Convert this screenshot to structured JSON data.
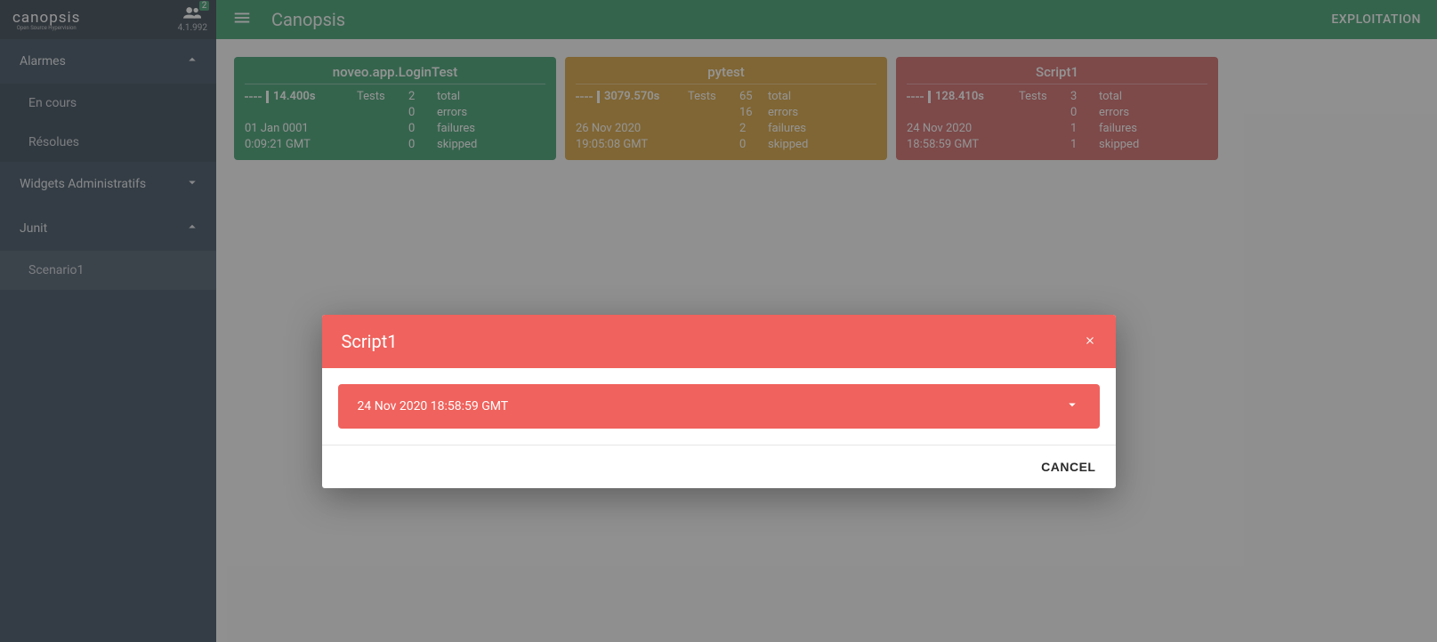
{
  "brand": {
    "name": "canopsis",
    "tagline": "Open Source Hypervision",
    "version": "4.1.992",
    "user_badge": "2"
  },
  "topbar": {
    "title": "Canopsis",
    "right": "EXPLOITATION"
  },
  "sidebar": {
    "groups": [
      {
        "label": "Alarmes",
        "expanded": true,
        "items": [
          {
            "label": "En cours",
            "active": false
          },
          {
            "label": "Résolues",
            "active": false
          }
        ]
      },
      {
        "label": "Widgets Administratifs",
        "expanded": false,
        "items": []
      },
      {
        "label": "Junit",
        "expanded": true,
        "items": [
          {
            "label": "Scenario1",
            "active": true
          }
        ]
      }
    ]
  },
  "stats_labels": {
    "tests": "Tests",
    "total": "total",
    "errors": "errors",
    "failures": "failures",
    "skipped": "skipped"
  },
  "cards": [
    {
      "color": "green",
      "title": "noveo.app.LoginTest",
      "duration": "14.400s",
      "date": "01 Jan 0001",
      "time": "0:09:21 GMT",
      "counts": {
        "total": "2",
        "errors": "0",
        "failures": "0",
        "skipped": "0"
      }
    },
    {
      "color": "orange",
      "title": "pytest",
      "duration": "3079.570s",
      "date": "26 Nov 2020",
      "time": "19:05:08 GMT",
      "counts": {
        "total": "65",
        "errors": "16",
        "failures": "2",
        "skipped": "0"
      }
    },
    {
      "color": "red",
      "title": "Script1",
      "duration": "128.410s",
      "date": "24 Nov 2020",
      "time": "18:58:59 GMT",
      "counts": {
        "total": "3",
        "errors": "0",
        "failures": "1",
        "skipped": "1"
      }
    }
  ],
  "modal": {
    "title": "Script1",
    "entry_label": "24 Nov 2020 18:58:59 GMT",
    "cancel": "CANCEL"
  }
}
